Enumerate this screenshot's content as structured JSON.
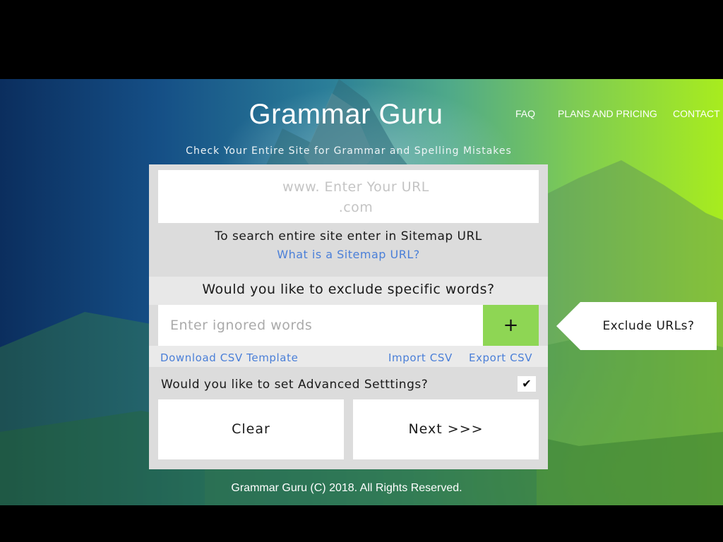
{
  "header": {
    "brand": "Grammar Guru",
    "tagline": "Check Your Entire Site for Grammar and Spelling Mistakes",
    "nav": [
      "FAQ",
      "PLANS AND PRICING",
      "CONTACT"
    ]
  },
  "form": {
    "url_placeholder": "www. Enter Your URL .com",
    "sitemap_hint": "To search entire site enter in Sitemap URL",
    "sitemap_link": "What is a Sitemap URL?",
    "exclude_question": "Would you like to exclude specific words?",
    "ignored_words_placeholder": "Enter ignored words",
    "add_label": "+",
    "download_csv": "Download CSV Template",
    "import_csv": "Import CSV",
    "export_csv": "Export CSV",
    "advanced_label": "Would you like to set Advanced Setttings?",
    "advanced_checked": true,
    "advanced_check_glyph": "✔",
    "clear_label": "Clear",
    "next_label": "Next >>>"
  },
  "side": {
    "exclude_urls_label": "Exclude URLs?"
  },
  "footer": {
    "text": "Grammar Guru (C) 2018. All Rights Reserved."
  },
  "colors": {
    "add_button": "#8ed654",
    "link": "#4a7fd8",
    "panel": "#dcdcdc"
  }
}
